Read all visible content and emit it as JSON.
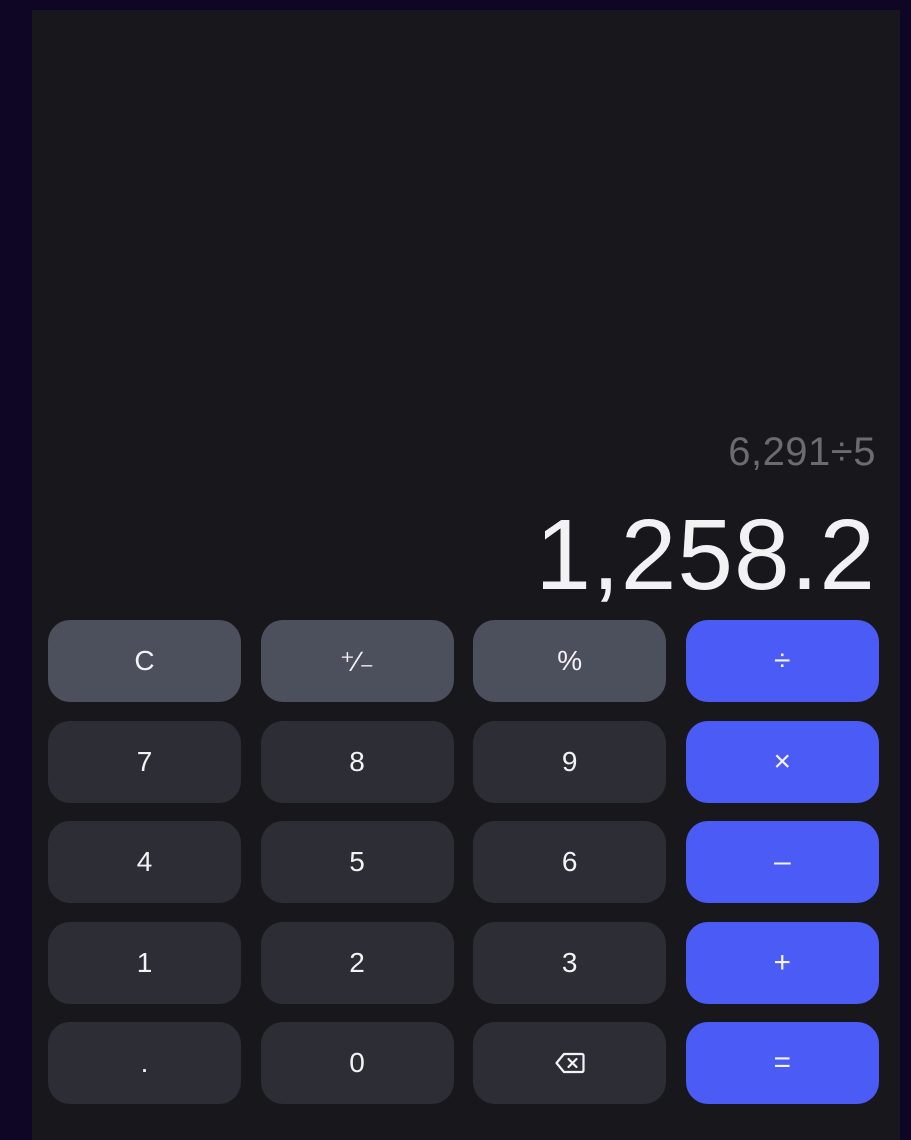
{
  "display": {
    "expression": "6,291÷5",
    "result": "1,258.2"
  },
  "keys": {
    "clear": "C",
    "sign": "⁺∕₋",
    "percent": "%",
    "divide": "÷",
    "seven": "7",
    "eight": "8",
    "nine": "9",
    "multiply": "×",
    "four": "4",
    "five": "5",
    "six": "6",
    "minus": "–",
    "one": "1",
    "two": "2",
    "three": "3",
    "plus": "+",
    "decimal": ".",
    "zero": "0",
    "backspace_icon": "backspace-icon",
    "equals": "="
  },
  "colors": {
    "background": "#0e0624",
    "panel": "#18171c",
    "number_key": "#2d2d35",
    "function_key": "#4c4f5c",
    "operator_key": "#4b5bf5",
    "expression_text": "#6b6b71",
    "result_text": "#f2f2f4"
  }
}
